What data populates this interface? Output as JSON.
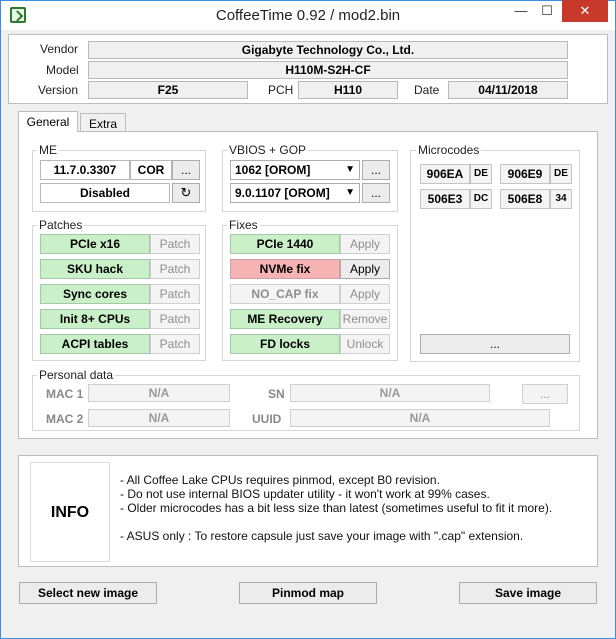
{
  "window": {
    "title": "CoffeeTime 0.92  /  mod2.bin",
    "minimize": "—",
    "maximize": "☐",
    "close": "✕"
  },
  "info": {
    "vendor_label": "Vendor",
    "vendor": "Gigabyte Technology Co., Ltd.",
    "model_label": "Model",
    "model": "H110M-S2H-CF",
    "version_label": "Version",
    "version": "F25",
    "pch_label": "PCH",
    "pch": "H110",
    "date_label": "Date",
    "date": "04/11/2018"
  },
  "tabs": [
    {
      "label": "General"
    },
    {
      "label": "Extra"
    }
  ],
  "me": {
    "title": "ME",
    "version": "11.7.0.3307",
    "type": "COR",
    "more": "...",
    "state": "Disabled"
  },
  "vbios": {
    "title": "VBIOS + GOP",
    "vbios": "1062 [OROM]",
    "gop": "9.0.1107 [OROM]",
    "more": "..."
  },
  "microcodes": {
    "title": "Microcodes",
    "items": [
      {
        "id": "906EA",
        "tag": "DE"
      },
      {
        "id": "906E9",
        "tag": "DE"
      },
      {
        "id": "506E3",
        "tag": "DC"
      },
      {
        "id": "506E8",
        "tag": "34"
      }
    ],
    "more": "..."
  },
  "patches": {
    "title": "Patches",
    "items": [
      {
        "name": "PCIe x16",
        "action": "Patch"
      },
      {
        "name": "SKU hack",
        "action": "Patch"
      },
      {
        "name": "Sync cores",
        "action": "Patch"
      },
      {
        "name": "Init 8+ CPUs",
        "action": "Patch"
      },
      {
        "name": "ACPI tables",
        "action": "Patch"
      }
    ]
  },
  "fixes": {
    "title": "Fixes",
    "items": [
      {
        "name": "PCIe 1440",
        "action": "Apply"
      },
      {
        "name": "NVMe fix",
        "action": "Apply"
      },
      {
        "name": "NO_CAP fix",
        "action": "Apply"
      },
      {
        "name": "ME Recovery",
        "action": "Remove"
      },
      {
        "name": "FD locks",
        "action": "Unlock"
      }
    ]
  },
  "personal": {
    "title": "Personal data",
    "mac1_label": "MAC 1",
    "mac1": "N/A",
    "mac2_label": "MAC 2",
    "mac2": "N/A",
    "sn_label": "SN",
    "sn": "N/A",
    "uuid_label": "UUID",
    "uuid": "N/A",
    "more": "..."
  },
  "notes": {
    "tag": "INFO",
    "lines": [
      "- All Coffee Lake CPUs requires pinmod, except B0 revision.",
      "- Do not use internal BIOS updater utility - it won't work at 99% cases.",
      "- Older microcodes has a bit less size than latest (sometimes useful to fit it more).",
      "- ASUS only : To restore capsule just save your image with \".cap\" extension."
    ]
  },
  "bottom": {
    "select": "Select new image",
    "pinmod": "Pinmod map",
    "save": "Save image"
  }
}
